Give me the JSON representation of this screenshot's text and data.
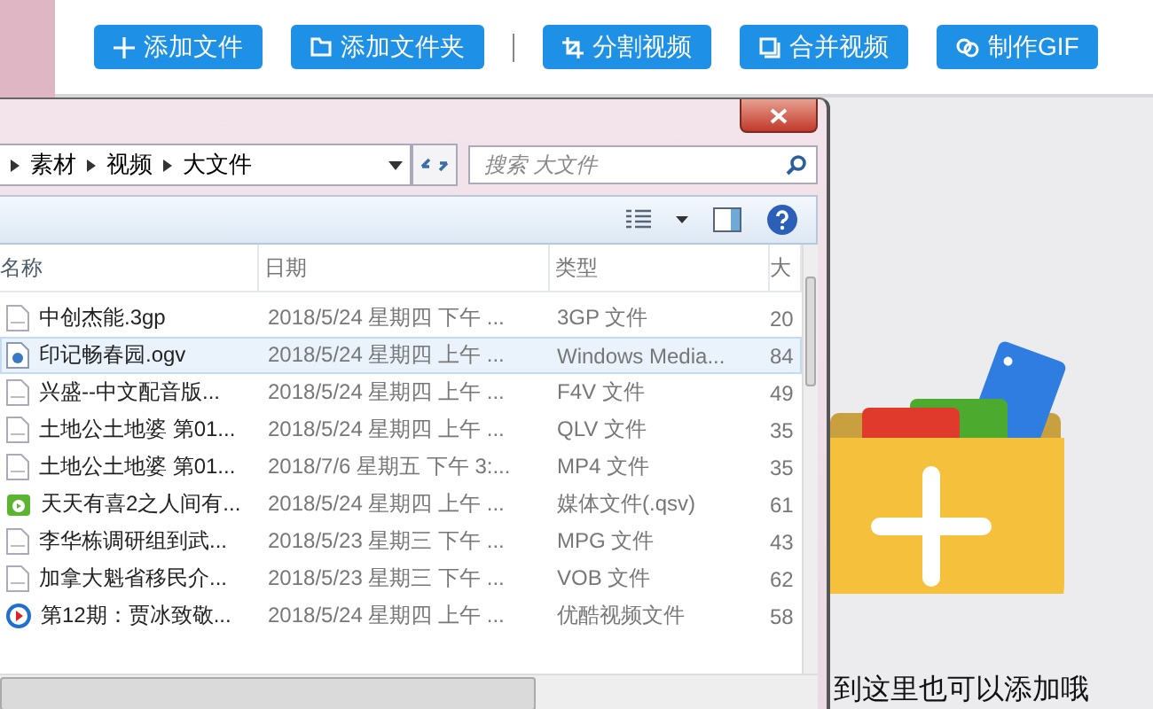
{
  "toolbar": {
    "buttons": [
      {
        "label": "添加文件"
      },
      {
        "label": "添加文件夹"
      },
      {
        "label": "分割视频"
      },
      {
        "label": "合并视频"
      },
      {
        "label": "制作GIF"
      }
    ]
  },
  "explorer": {
    "breadcrumb": [
      "素材",
      "视频",
      "大文件"
    ],
    "search": {
      "placeholder": "搜索 大文件"
    },
    "columns": [
      "名称",
      "日期",
      "类型",
      "大"
    ],
    "rows": [
      {
        "kind": "doc",
        "name": "中创杰能.3gp",
        "date": "2018/5/24 星期四 下午 ...",
        "type": "3GP 文件",
        "size": "20",
        "selected": false
      },
      {
        "kind": "media",
        "name": "印记畅春园.ogv",
        "date": "2018/5/24 星期四 上午 ...",
        "type": "Windows Media...",
        "size": "84",
        "selected": true
      },
      {
        "kind": "doc",
        "name": "兴盛--中文配音版...",
        "date": "2018/5/24 星期四 上午 ...",
        "type": "F4V 文件",
        "size": "49",
        "selected": false
      },
      {
        "kind": "doc",
        "name": "土地公土地婆 第01...",
        "date": "2018/5/24 星期四 上午 ...",
        "type": "QLV 文件",
        "size": "35",
        "selected": false
      },
      {
        "kind": "doc",
        "name": "土地公土地婆 第01...",
        "date": "2018/7/6 星期五 下午 3:...",
        "type": "MP4 文件",
        "size": "35",
        "selected": false
      },
      {
        "kind": "qsv",
        "name": "天天有喜2之人间有...",
        "date": "2018/5/24 星期四 上午 ...",
        "type": "媒体文件(.qsv)",
        "size": "61",
        "selected": false
      },
      {
        "kind": "doc",
        "name": "李华栋调研组到武...",
        "date": "2018/5/23 星期三 下午 ...",
        "type": "MPG 文件",
        "size": "43",
        "selected": false
      },
      {
        "kind": "doc",
        "name": "加拿大魁省移民介...",
        "date": "2018/5/23 星期三 下午 ...",
        "type": "VOB 文件",
        "size": "62",
        "selected": false
      },
      {
        "kind": "youku",
        "name": "第12期：贾冰致敬...",
        "date": "2018/5/24 星期四 上午 ...",
        "type": "优酷视频文件",
        "size": "58",
        "selected": false
      }
    ]
  },
  "drop_hint": "到这里也可以添加哦"
}
